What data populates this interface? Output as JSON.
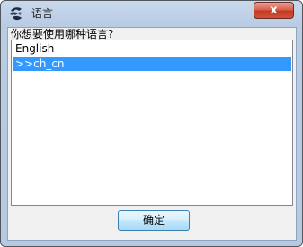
{
  "window": {
    "title": "语言",
    "close_label": "x"
  },
  "dialog": {
    "prompt": "你想要使用哪种语言?",
    "languages": [
      {
        "label": "English",
        "selected": false
      },
      {
        "label": ">>ch_cn",
        "selected": true
      }
    ],
    "ok_label": "确定"
  },
  "colors": {
    "selection": "#3399ff",
    "close_button": "#c5391f",
    "title_bar": "#b9cce4"
  },
  "icons": {
    "app": "cheat-engine-icon",
    "close": "close-icon"
  }
}
